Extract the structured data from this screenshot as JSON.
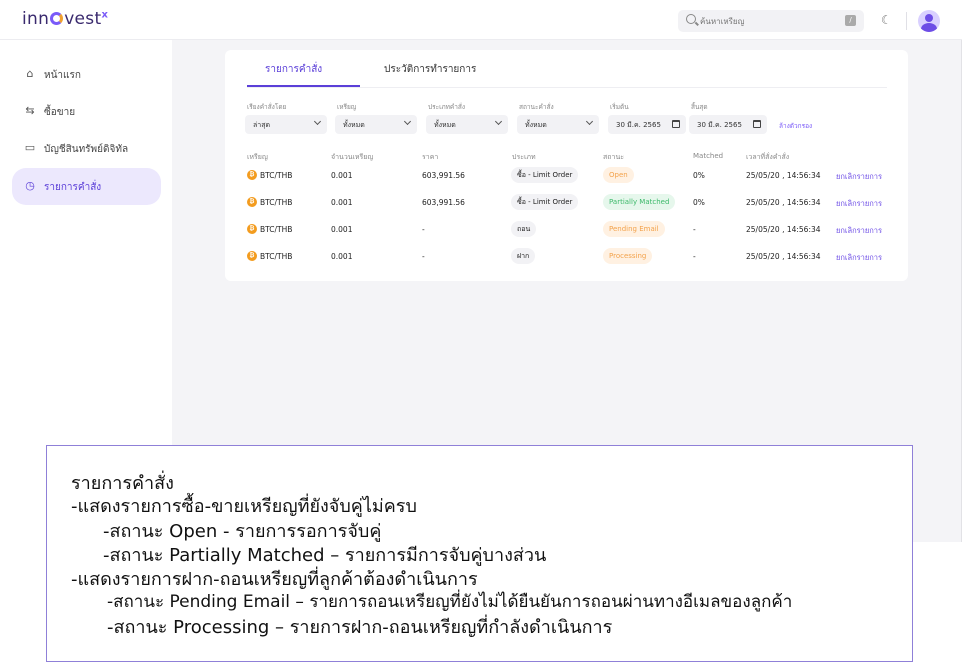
{
  "brand": {
    "logo_left": "inn",
    "logo_right": "vest",
    "logo_mark": "x"
  },
  "topbar": {
    "search_placeholder": "ค้นหาเหรียญ",
    "shortcut": "/"
  },
  "sidebar": {
    "items": [
      {
        "label": "หน้าแรก",
        "icon": "home-icon"
      },
      {
        "label": "ซื้อขาย",
        "icon": "swap-icon"
      },
      {
        "label": "บัญชีสินทรัพย์ดิจิทัล",
        "icon": "wallet-icon"
      },
      {
        "label": "รายการคำสั่ง",
        "icon": "clock-icon",
        "active": true
      }
    ]
  },
  "tabs": [
    {
      "label": "รายการคำสั่ง",
      "active": true
    },
    {
      "label": "ประวัติการทำรายการ",
      "active": false
    }
  ],
  "filters": [
    {
      "label": "เรียงคำสั่งโดย",
      "value": "ล่าสุด"
    },
    {
      "label": "เหรียญ",
      "value": "ทั้งหมด"
    },
    {
      "label": "ประเภทคำสั่ง",
      "value": "ทั้งหมด"
    },
    {
      "label": "สถานะคำสั่ง",
      "value": "ทั้งหมด"
    },
    {
      "label": "เริ่มต้น",
      "value": "30 มี.ค. 2565"
    },
    {
      "label": "สิ้นสุด",
      "value": "30 มี.ค. 2565"
    }
  ],
  "clear_filter": "ล้างตัวกรอง",
  "table": {
    "headers": [
      "เหรียญ",
      "จำนวนเหรียญ",
      "ราคา",
      "ประเภท",
      "สถานะ",
      "Matched",
      "เวลาที่สั่งคำสั่ง"
    ],
    "rows": [
      {
        "coin": "BTC/THB",
        "amount": "0.001",
        "price": "603,991.56",
        "type": "ซื้อ - Limit Order",
        "status": "Open",
        "matched": "0%",
        "time": "25/05/20 , 14:56:34",
        "action": "ยกเลิกรายการ"
      },
      {
        "coin": "BTC/THB",
        "amount": "0.001",
        "price": "603,991.56",
        "type": "ซื้อ - Limit Order",
        "status": "Partially Matched",
        "matched": "0%",
        "time": "25/05/20 , 14:56:34",
        "action": "ยกเลิกรายการ"
      },
      {
        "coin": "BTC/THB",
        "amount": "0.001",
        "price": "-",
        "type": "ถอน",
        "status": "Pending Email",
        "matched": "-",
        "time": "25/05/20 , 14:56:34",
        "action": "ยกเลิกรายการ"
      },
      {
        "coin": "BTC/THB",
        "amount": "0.001",
        "price": "-",
        "type": "ฝาก",
        "status": "Processing",
        "matched": "-",
        "time": "25/05/20 , 14:56:34",
        "action": "ยกเลิกรายการ"
      }
    ]
  },
  "note": {
    "lines": [
      "รายการคำสั่ง",
      "-แสดงรายการซื้อ-ขายเหรียญที่ยังจับคู่ไม่ครบ",
      "-สถานะ Open - รายการรอการจับคู่",
      "-สถานะ Partially Matched – รายการมีการจับคู่บางส่วน",
      "-แสดงรายการฝาก-ถอนเหรียญที่ลูกค้าต้องดำเนินการ",
      "-สถานะ Pending Email – รายการถอนเหรียญที่ยังไม่ได้ยืนยันการถอนผ่านทางอีเมลของลูกค้า",
      "-สถานะ Processing – รายการฝาก-ถอนเหรียญที่กำลังดำเนินการ"
    ]
  },
  "colors": {
    "accent": "#5b3fd8",
    "open": "#f3a24b",
    "partial": "#3cb96a",
    "coin": "#f39c1f"
  }
}
